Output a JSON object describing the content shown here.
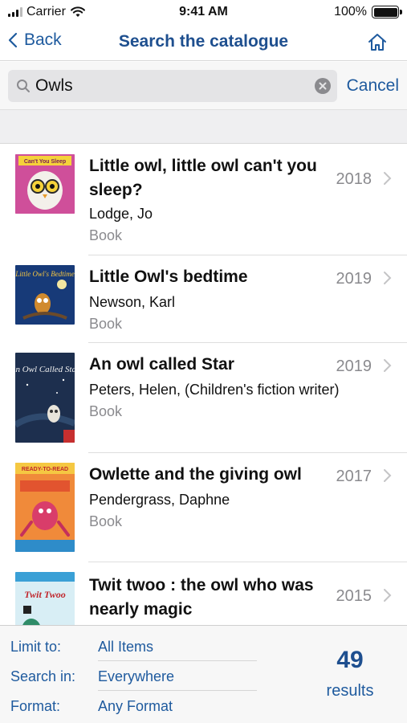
{
  "status_bar": {
    "carrier": "Carrier",
    "time": "9:41 AM",
    "battery": "100%"
  },
  "nav": {
    "back_label": "Back",
    "title": "Search the catalogue"
  },
  "search": {
    "query": "Owls",
    "cancel_label": "Cancel"
  },
  "results": [
    {
      "title": "Little owl, little owl can't you sleep?",
      "author": "Lodge, Jo",
      "format": "Book",
      "year": "2018",
      "cover_text": "Can't You Sleep"
    },
    {
      "title": "Little Owl's bedtime",
      "author": "Newson, Karl",
      "format": "Book",
      "year": "2019",
      "cover_text": "Little Owl's Bedtime"
    },
    {
      "title": "An owl called Star",
      "author": "Peters, Helen, (Children's fiction writer)",
      "format": "Book",
      "year": "2019",
      "cover_text": "An Owl Called Star"
    },
    {
      "title": "Owlette and the giving owl",
      "author": "Pendergrass, Daphne",
      "format": "Book",
      "year": "2017",
      "cover_text": "READY-TO-READ"
    },
    {
      "title": "Twit twoo : the owl who was nearly magic",
      "author": "",
      "format": "",
      "year": "2015",
      "cover_text": "Twit Twoo"
    }
  ],
  "filters": {
    "limit_label": "Limit to:",
    "limit_value": "All Items",
    "search_in_label": "Search in:",
    "search_in_value": "Everywhere",
    "format_label": "Format:",
    "format_value": "Any Format"
  },
  "result_count": {
    "number": "49",
    "label": "results"
  },
  "colors": {
    "accent": "#1e5a9e",
    "title_blue": "#1e4f8f",
    "secondary_text": "#8a8a8e"
  }
}
